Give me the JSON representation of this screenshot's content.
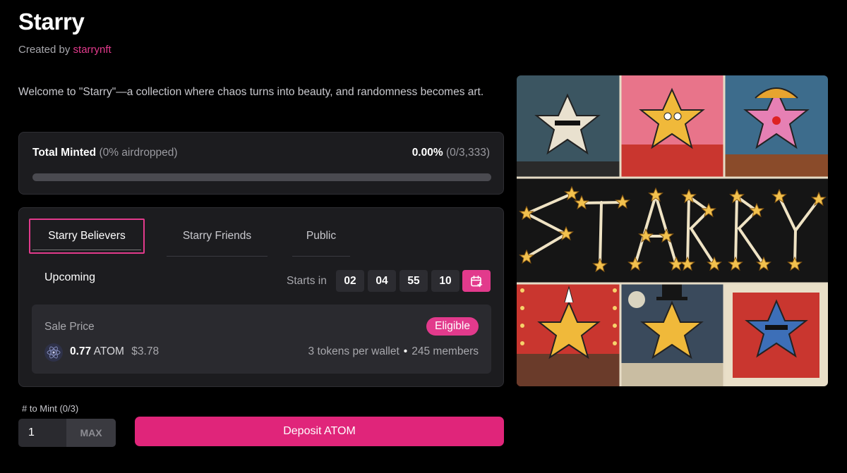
{
  "header": {
    "title": "Starry",
    "created_prefix": "Created by ",
    "creator": "starrynft"
  },
  "description": "Welcome to \"Starry\"—a collection where chaos turns into beauty, and randomness becomes art.",
  "mint_status": {
    "label": "Total Minted",
    "airdrop_note": "(0% airdropped)",
    "percent": "0.00%",
    "count": "(0/3,333)",
    "progress": 0.0
  },
  "phases": {
    "tabs": [
      {
        "label": "Starry Believers",
        "active": true
      },
      {
        "label": "Starry Friends",
        "active": false
      },
      {
        "label": "Public",
        "active": false
      }
    ],
    "status": "Upcoming",
    "starts_in_label": "Starts in",
    "countdown": [
      "02",
      "04",
      "55",
      "10"
    ],
    "calendar_icon": "calendar-add-icon"
  },
  "sale": {
    "label": "Sale Price",
    "badge": "Eligible",
    "price": "0.77",
    "unit": "ATOM",
    "usd": "$3.78",
    "per_wallet": "3 tokens per wallet",
    "separator": "•",
    "members": "245 members",
    "token_icon": "atom-logo-icon"
  },
  "mint_form": {
    "label": "# to Mint (0/3)",
    "quantity": "1",
    "max_label": "MAX",
    "deposit_label": "Deposit ATOM"
  },
  "artwork": {
    "word": "STARRY"
  },
  "colors": {
    "accent": "#e23a8c",
    "background": "#000000",
    "panel": "#1c1c1f"
  }
}
